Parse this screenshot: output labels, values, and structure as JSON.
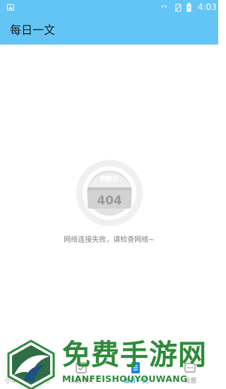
{
  "status_bar": {
    "time": "4:03",
    "data_indicator": "‹·›"
  },
  "app_bar": {
    "title": "每日一文"
  },
  "error": {
    "badge_label": "倒数日",
    "code": "404",
    "message": "网络连接失败，请检查网络~"
  },
  "bottom_nav": {
    "items": [
      {
        "label": "小羊日程倒计时",
        "icon": "home-icon",
        "active": false
      },
      {
        "label": "历史今天",
        "icon": "checkbox-icon",
        "active": false
      },
      {
        "label": "每日一文",
        "icon": "article-icon",
        "active": true
      },
      {
        "label": "设置",
        "icon": "settings-icon",
        "active": false
      }
    ]
  },
  "watermark": {
    "title": "免费手游网",
    "subtitle": "MIANFEISHOUYOUWANG"
  },
  "colors": {
    "header": "#63c5f6",
    "active_tab": "#1e88d6",
    "inactive_tab": "#9a9a9a",
    "watermark": "#2e8a3a"
  }
}
